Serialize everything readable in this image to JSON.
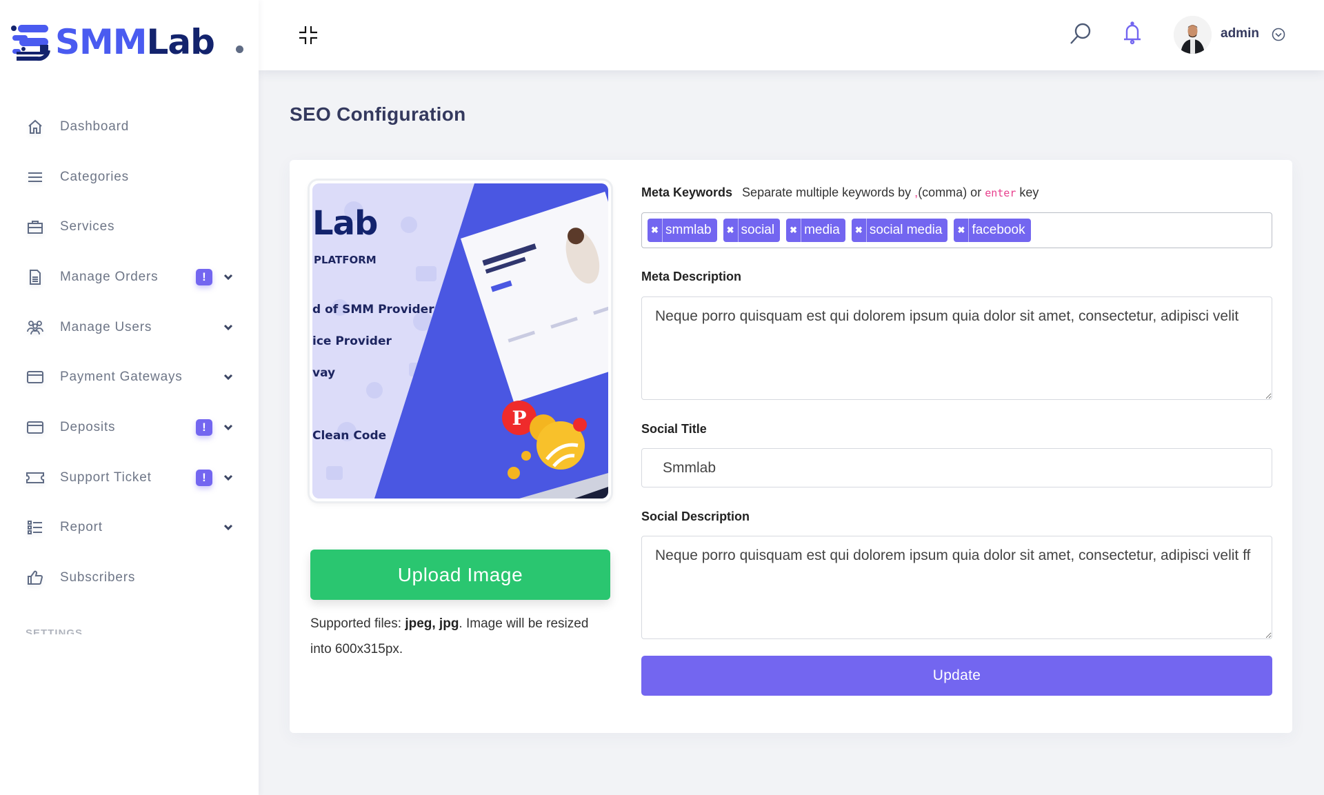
{
  "brand": {
    "name_part1": "SMM",
    "name_part2": "Lab",
    "primary_color": "#4a5bf0",
    "secondary_color": "#13236d"
  },
  "sidebar": {
    "items": [
      {
        "label": "Dashboard",
        "icon": "home-icon",
        "badge": null,
        "has_submenu": false
      },
      {
        "label": "Categories",
        "icon": "menu-lines-icon",
        "badge": null,
        "has_submenu": false
      },
      {
        "label": "Services",
        "icon": "briefcase-icon",
        "badge": null,
        "has_submenu": false
      },
      {
        "label": "Manage Orders",
        "icon": "document-icon",
        "badge": "!",
        "has_submenu": true
      },
      {
        "label": "Manage Users",
        "icon": "users-icon",
        "badge": null,
        "has_submenu": true
      },
      {
        "label": "Payment Gateways",
        "icon": "credit-card-icon",
        "badge": null,
        "has_submenu": true
      },
      {
        "label": "Deposits",
        "icon": "credit-card-icon",
        "badge": "!",
        "has_submenu": true
      },
      {
        "label": "Support Ticket",
        "icon": "ticket-icon",
        "badge": "!",
        "has_submenu": true
      },
      {
        "label": "Report",
        "icon": "list-icon",
        "badge": null,
        "has_submenu": true
      },
      {
        "label": "Subscribers",
        "icon": "thumbs-up-icon",
        "badge": null,
        "has_submenu": false
      }
    ],
    "section_heading": "SETTINGS",
    "badge_color": "#7366f0"
  },
  "topbar": {
    "username": "admin",
    "notification_color": "#7366f0"
  },
  "page": {
    "title": "SEO Configuration"
  },
  "image_panel": {
    "preview_lines": [
      "Lab",
      "PLATFORM",
      "d of SMM Provider",
      "ice Provider",
      "vay",
      "Clean Code"
    ],
    "upload_label": "Upload Image",
    "upload_color": "#2ac670",
    "help_prefix": "Supported files: ",
    "help_formats": "jpeg, jpg",
    "help_suffix": ". Image will be resized into 600x315px."
  },
  "form": {
    "meta_keywords": {
      "label": "Meta Keywords",
      "hint_prefix": "Separate multiple keywords by ",
      "hint_comma": ",",
      "hint_middle": "(comma) or ",
      "hint_code": "enter",
      "hint_suffix": " key",
      "tags": [
        "smmlab",
        "social",
        "media",
        "social media",
        "facebook"
      ],
      "tag_color": "#7366f0"
    },
    "meta_description": {
      "label": "Meta Description",
      "value": "Neque porro quisquam est qui dolorem ipsum quia dolor sit amet, consectetur, adipisci velit"
    },
    "social_title": {
      "label": "Social Title",
      "value": "Smmlab"
    },
    "social_description": {
      "label": "Social Description",
      "value": "Neque porro quisquam est qui dolorem ipsum quia dolor sit amet, consectetur, adipisci velit ff"
    },
    "submit_label": "Update",
    "submit_color": "#7366f0"
  }
}
